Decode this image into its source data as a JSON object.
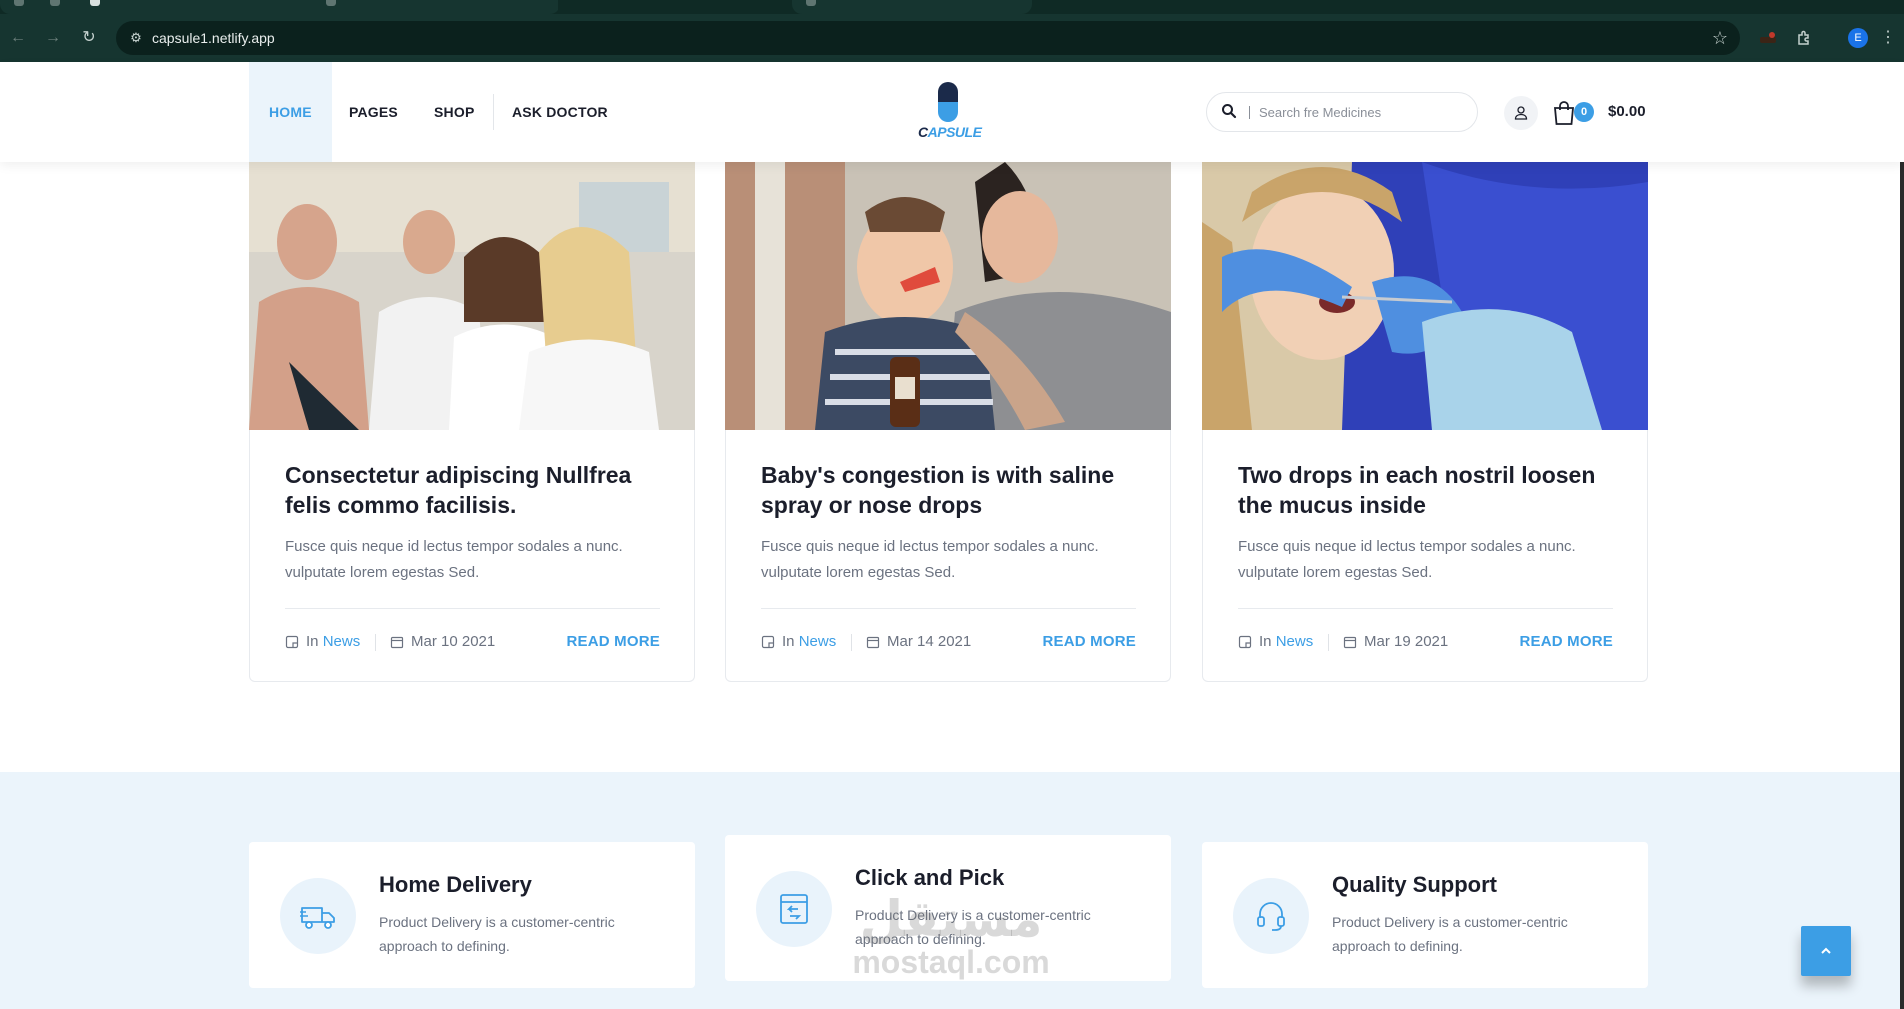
{
  "browser": {
    "url": "capsule1.netlify.app",
    "profile_initial": "E"
  },
  "header": {
    "nav": [
      {
        "label": "HOME"
      },
      {
        "label": "PAGES"
      },
      {
        "label": "SHOP"
      },
      {
        "label": "ASK DOCTOR"
      }
    ],
    "logo_text_dark": "C",
    "logo_text_accent": "APSULE",
    "search_placeholder": "Search fre Medicines",
    "cart_count": "0",
    "cart_total": "$0.00"
  },
  "posts": [
    {
      "title": "Consectetur adipiscing Nullfrea felis commo facilisis.",
      "excerpt": "Fusce quis neque id lectus tempor sodales a nunc. vulputate lorem egestas Sed.",
      "in_label": "In",
      "category": "News",
      "date": "Mar 10 2021",
      "read_more": "READ MORE"
    },
    {
      "title": "Baby's congestion is with saline spray or nose drops",
      "excerpt": "Fusce quis neque id lectus tempor sodales a nunc. vulputate lorem egestas Sed.",
      "in_label": "In",
      "category": "News",
      "date": "Mar 14 2021",
      "read_more": "READ MORE"
    },
    {
      "title": "Two drops in each nostril loosen the mucus inside",
      "excerpt": "Fusce quis neque id lectus tempor sodales a nunc. vulputate lorem egestas Sed.",
      "in_label": "In",
      "category": "News",
      "date": "Mar 19 2021",
      "read_more": "READ MORE"
    }
  ],
  "features": [
    {
      "title": "Home Delivery",
      "desc": "Product Delivery is a customer-centric approach to defining.",
      "icon": "delivery-truck-icon"
    },
    {
      "title": "Click and Pick",
      "desc": "Product Delivery is a customer-centric approach to defining.",
      "icon": "click-pick-icon"
    },
    {
      "title": "Quality Support",
      "desc": "Product Delivery is a customer-centric approach to defining.",
      "icon": "headset-icon"
    }
  ],
  "watermark": {
    "arabic": "مستقل",
    "latin": "mostaql.com"
  },
  "colors": {
    "accent": "#3c9ee5",
    "dark": "#1b1e2b",
    "band": "#ebf4fb",
    "browser": "#163530"
  }
}
